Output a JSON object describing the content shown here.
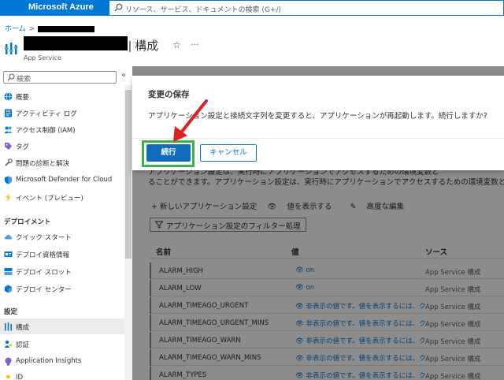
{
  "app": {
    "brand": "Microsoft Azure",
    "search_placeholder": "リソース、サービス、ドキュメントの検索 (G+/)"
  },
  "breadcrumb": {
    "home": "ホーム",
    "separator": ">"
  },
  "header": {
    "title": "| 構成",
    "resource_type": "App Service",
    "favorite_icon": "☆",
    "more_icon": "···"
  },
  "sidebar": {
    "search_placeholder": "検索",
    "collapse_icon": "«",
    "items": [
      {
        "label": "概要",
        "icon": "globe-icon"
      },
      {
        "label": "アクティビティ ログ",
        "icon": "log-icon"
      },
      {
        "label": "アクセス制御 (IAM)",
        "icon": "people-icon"
      },
      {
        "label": "タグ",
        "icon": "tag-icon"
      },
      {
        "label": "問題の診断と解決",
        "icon": "wrench-icon"
      },
      {
        "label": "Microsoft Defender for Cloud",
        "icon": "shield-icon"
      },
      {
        "label": "イベント (プレビュー)",
        "icon": "lightning-icon"
      }
    ],
    "section_deploy": "デプロイメント",
    "deploy_items": [
      {
        "label": "クイック スタート",
        "icon": "cloud-icon"
      },
      {
        "label": "デプロイ資格情報",
        "icon": "credentials-icon"
      },
      {
        "label": "デプロイ スロット",
        "icon": "slots-icon"
      },
      {
        "label": "デプロイ センター",
        "icon": "cube-icon"
      }
    ],
    "section_settings": "設定",
    "settings_items": [
      {
        "label": "構成",
        "icon": "config-bars-icon",
        "active": true
      },
      {
        "label": "認証",
        "icon": "person-key-icon"
      },
      {
        "label": "Application Insights",
        "icon": "bulb-icon"
      },
      {
        "label": "ID",
        "icon": "identity-icon"
      }
    ]
  },
  "content": {
    "intro_line1": "アプリケーション設定は、実行時にアプリケーションでアクセスするための環境変数と",
    "intro_line2": "ることができます。アプリケーション設定は、実行時にアプリケーションでアクセスするための環境変数と",
    "toolbar": {
      "new_setting": "+ 新しいアプリケーション設定",
      "show_values": "値を表示する",
      "advanced_edit": "高度な編集"
    },
    "filter_label": "アプリケーション設定のフィルター処理",
    "columns": [
      "名前",
      "値",
      "ソース"
    ],
    "rows": [
      {
        "name": "ALARM_HIGH",
        "value": "on",
        "source": "App Service 構成"
      },
      {
        "name": "ALARM_LOW",
        "value": "on",
        "source": "App Service 構成"
      },
      {
        "name": "ALARM_TIMEAGO_URGENT",
        "value": "非表示の値です。値を表示するには、ク",
        "source": "App Service 構成"
      },
      {
        "name": "ALARM_TIMEAGO_URGENT_MINS",
        "value": "非表示の値です。値を表示するには、ク",
        "source": "App Service 構成"
      },
      {
        "name": "ALARM_TIMEAGO_WARN",
        "value": "非表示の値です。値を表示するには、ク",
        "source": "App Service 構成"
      },
      {
        "name": "ALARM_TIMEAGO_WARN_MINS",
        "value": "非表示の値です。値を表示するには、ク",
        "source": "App Service 構成"
      },
      {
        "name": "ALARM_TYPES",
        "value": "非表示の値です。値を表示するには、ク",
        "source": "App Service 構成"
      }
    ]
  },
  "dialog": {
    "title": "変更の保存",
    "message": "アプリケーション設定と接続文字列を変更すると、アプリケーションが再起動します。続行しますか?",
    "continue": "続行",
    "cancel": "キャンセル"
  },
  "colors": {
    "azure_blue": "#0078d4",
    "primary_button": "#0f6cbd",
    "highlight_green": "#3cb04a",
    "arrow_red": "#e02020"
  }
}
